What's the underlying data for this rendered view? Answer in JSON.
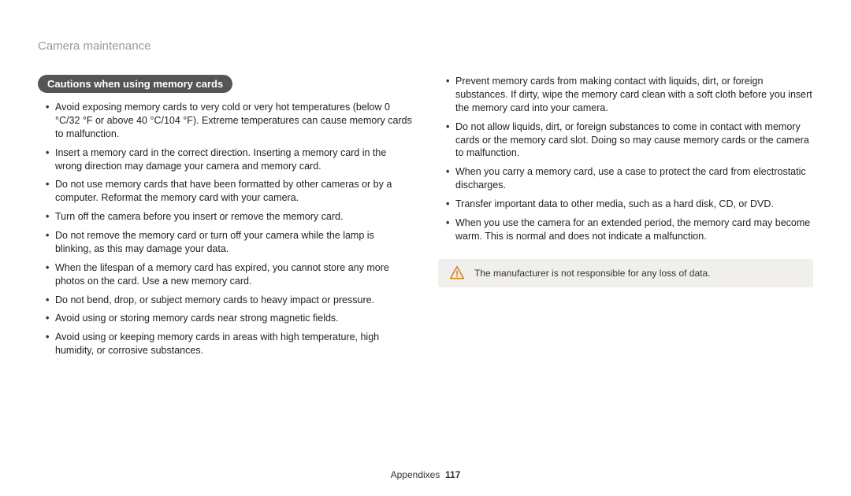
{
  "header": {
    "title": "Camera maintenance"
  },
  "section": {
    "badge": "Cautions when using memory cards"
  },
  "left_bullets": [
    "Avoid exposing memory cards to very cold or very hot temperatures (below 0 °C/32 °F or above 40 °C/104 °F). Extreme temperatures can cause memory cards to malfunction.",
    "Insert a memory card in the correct direction. Inserting a memory card in the wrong direction may damage your camera and memory card.",
    "Do not use memory cards that have been formatted by other cameras or by a computer. Reformat the memory card with your camera.",
    "Turn off the camera before you insert or remove the memory card.",
    "Do not remove the memory card or turn off your camera while the lamp is blinking, as this may damage your data.",
    "When the lifespan of a memory card has expired, you cannot store any more photos on the card. Use a new memory card.",
    "Do not bend, drop, or subject memory cards to heavy impact or pressure.",
    "Avoid using or storing memory cards near strong magnetic fields.",
    "Avoid using or keeping memory cards in areas with high temperature, high humidity, or corrosive substances."
  ],
  "right_bullets": [
    "Prevent memory cards from making contact with liquids, dirt, or foreign substances. If dirty, wipe the memory card clean with a soft cloth before you insert the memory card into your camera.",
    "Do not allow liquids, dirt, or foreign substances to come in contact with memory cards or the memory card slot. Doing so may cause memory cards or the camera to malfunction.",
    "When you carry a memory card, use a case to protect the card from electrostatic discharges.",
    "Transfer important data to other media, such as a hard disk, CD, or DVD.",
    "When you use the camera for an extended period, the memory card may become warm. This is normal and does not indicate a malfunction."
  ],
  "note": {
    "text": "The manufacturer is not responsible for any loss of data."
  },
  "footer": {
    "section": "Appendixes",
    "page": "117"
  }
}
